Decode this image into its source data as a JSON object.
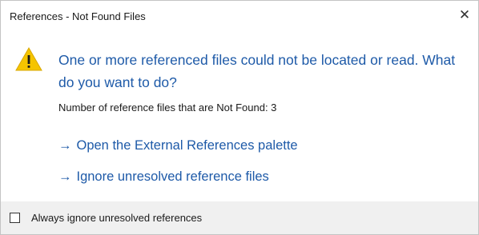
{
  "window": {
    "title": "References - Not Found Files",
    "close_glyph": "✕"
  },
  "content": {
    "main_instruction": "One or more referenced files could not be located or read. What do you want to do?",
    "count_text": "Number of reference files that are Not Found: 3",
    "icon": "warning-icon",
    "accent_color": "#1e5aa8",
    "warning_color": "#f5c400"
  },
  "links": {
    "arrow": "→",
    "open_palette": "Open the External References palette",
    "ignore_unresolved": "Ignore unresolved reference files"
  },
  "footer": {
    "checkbox_label": "Always ignore unresolved references",
    "checkbox_checked": false
  }
}
